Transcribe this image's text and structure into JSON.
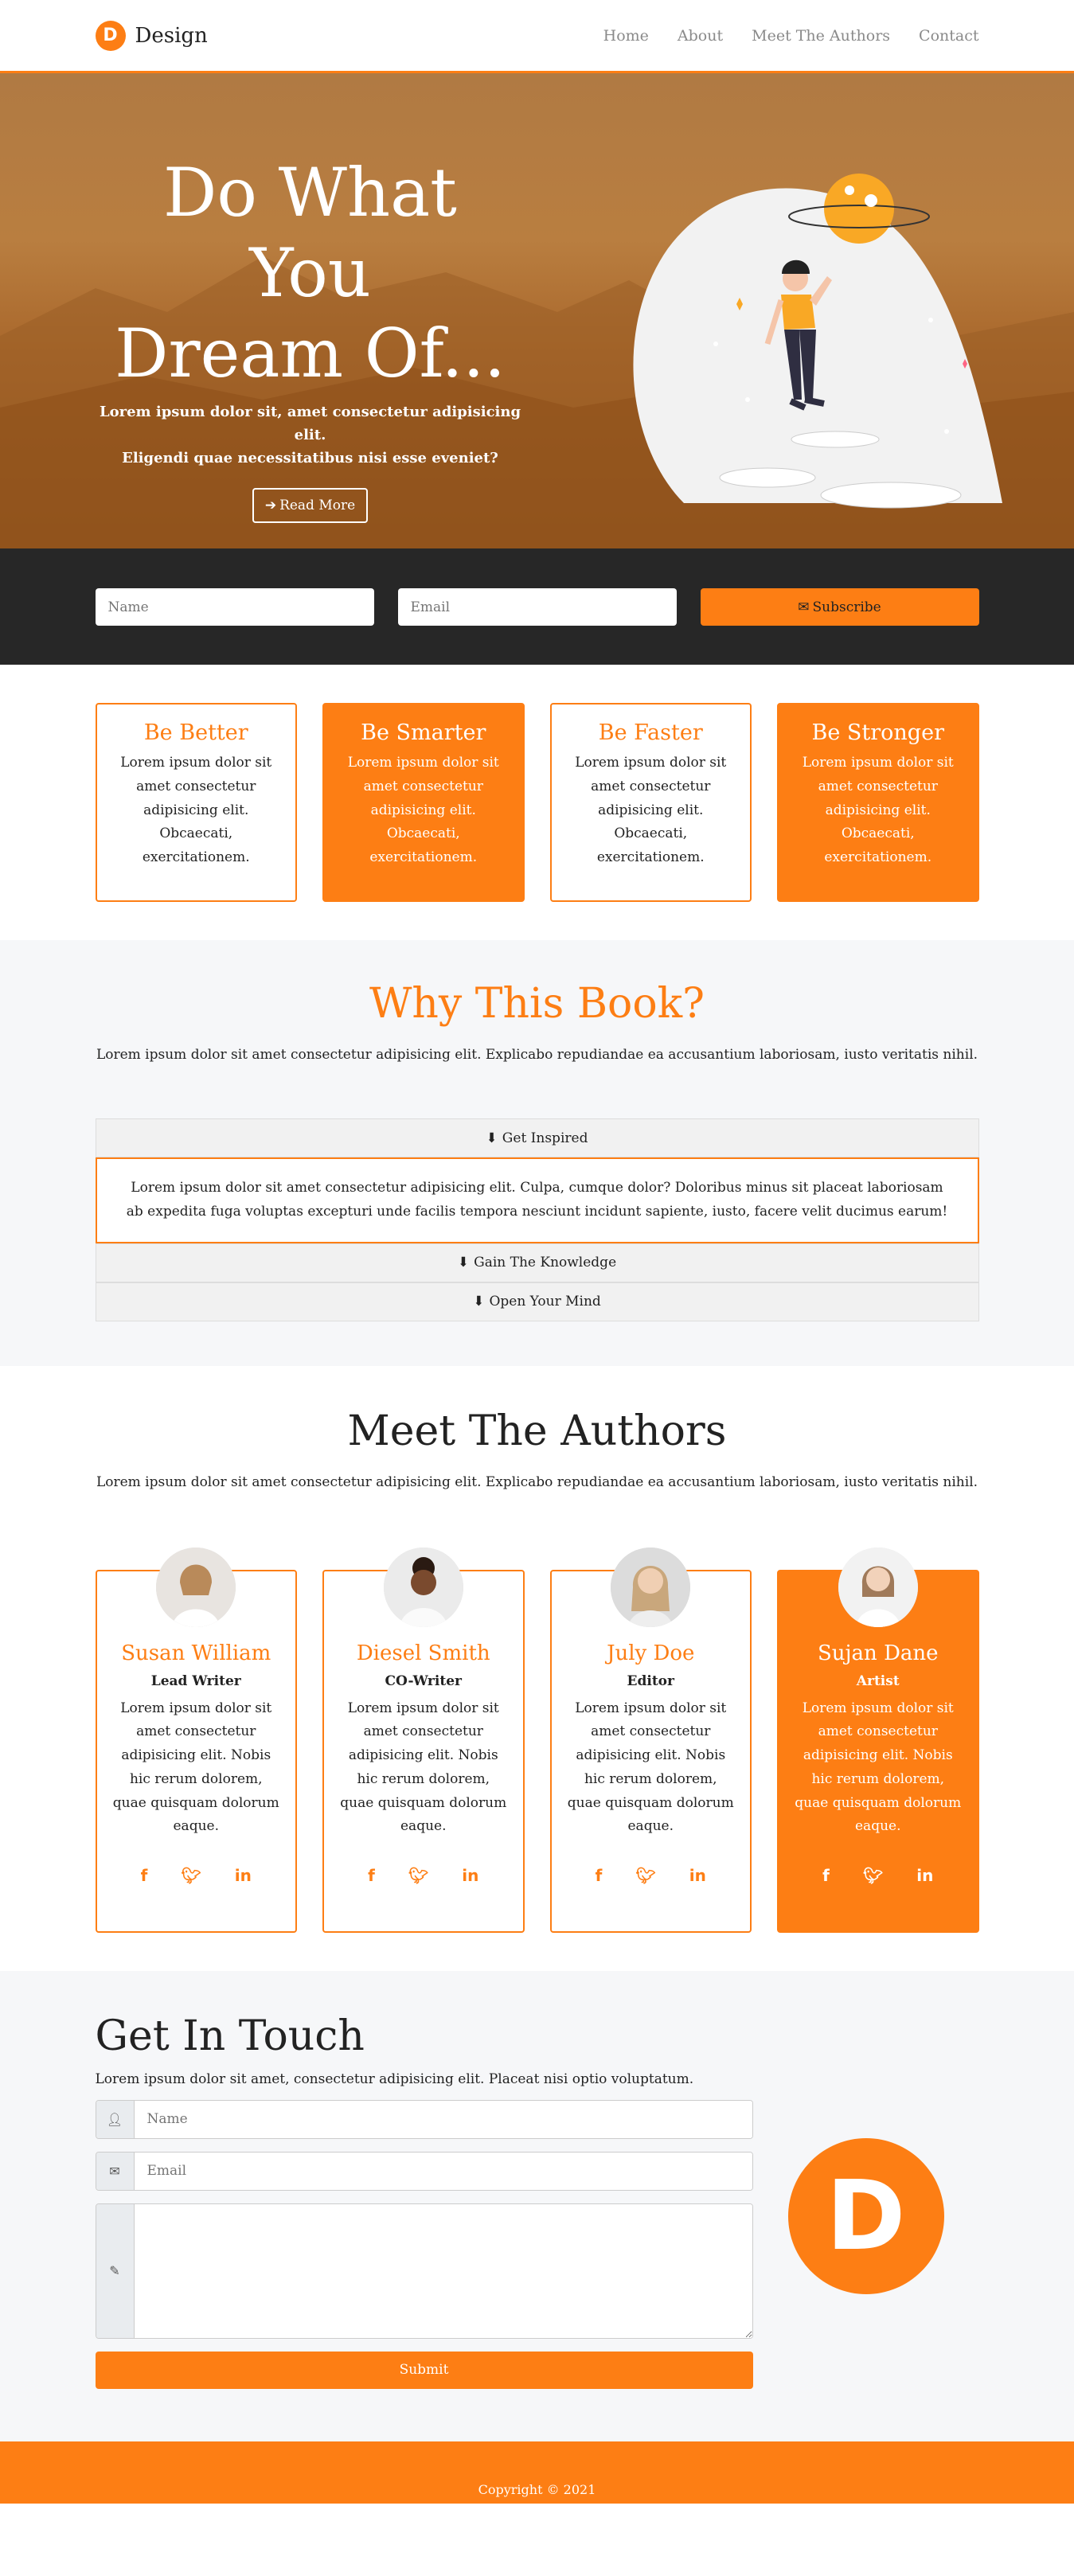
{
  "nav": {
    "logo_letter": "D",
    "brand": "Design",
    "links": [
      "Home",
      "About",
      "Meet The Authors",
      "Contact"
    ]
  },
  "hero": {
    "title_line1": "Do What You",
    "title_line2": "Dream Of...",
    "subtitle_line1": "Lorem ipsum dolor sit, amet consectetur adipisicing elit.",
    "subtitle_line2": "Eligendi quae necessitatibus nisi esse eveniet?",
    "button": "Read More"
  },
  "subscribe": {
    "name_placeholder": "Name",
    "email_placeholder": "Email",
    "button": "Subscribe"
  },
  "features": [
    {
      "title": "Be Better",
      "text": "Lorem ipsum dolor sit amet consectetur adipisicing elit. Obcaecati, exercitationem."
    },
    {
      "title": "Be Smarter",
      "text": "Lorem ipsum dolor sit amet consectetur adipisicing elit. Obcaecati, exercitationem."
    },
    {
      "title": "Be Faster",
      "text": "Lorem ipsum dolor sit amet consectetur adipisicing elit. Obcaecati, exercitationem."
    },
    {
      "title": "Be Stronger",
      "text": "Lorem ipsum dolor sit amet consectetur adipisicing elit. Obcaecati, exercitationem."
    }
  ],
  "why": {
    "title": "Why This Book?",
    "lead": "Lorem ipsum dolor sit amet consectetur adipisicing elit. Explicabo repudiandae ea accusantium laboriosam, iusto veritatis nihil.",
    "accordion": [
      {
        "label": "Get Inspired",
        "body": "Lorem ipsum dolor sit amet consectetur adipisicing elit. Culpa, cumque dolor? Doloribus minus sit placeat laboriosam ab expedita fuga voluptas excepturi unde facilis tempora nesciunt incidunt sapiente, iusto, facere velit ducimus earum!"
      },
      {
        "label": "Gain The Knowledge"
      },
      {
        "label": "Open Your Mind"
      }
    ]
  },
  "authors": {
    "title": "Meet The Authors",
    "lead": "Lorem ipsum dolor sit amet consectetur adipisicing elit. Explicabo repudiandae ea accusantium laboriosam, iusto veritatis nihil.",
    "cards": [
      {
        "name": "Susan William",
        "role": "Lead Writer",
        "text": "Lorem ipsum dolor sit amet consectetur adipisicing elit. Nobis hic rerum dolorem, quae quisquam dolorum eaque."
      },
      {
        "name": "Diesel Smith",
        "role": "CO-Writer",
        "text": "Lorem ipsum dolor sit amet consectetur adipisicing elit. Nobis hic rerum dolorem, quae quisquam dolorum eaque."
      },
      {
        "name": "July Doe",
        "role": "Editor",
        "text": "Lorem ipsum dolor sit amet consectetur adipisicing elit. Nobis hic rerum dolorem, quae quisquam dolorum eaque."
      },
      {
        "name": "Sujan Dane",
        "role": "Artist",
        "text": "Lorem ipsum dolor sit amet consectetur adipisicing elit. Nobis hic rerum dolorem, quae quisquam dolorum eaque."
      }
    ],
    "social": {
      "facebook": "f",
      "twitter": "twitter",
      "linkedin": "in"
    }
  },
  "contact": {
    "title": "Get In Touch",
    "lead": "Lorem ipsum dolor sit amet, consectetur adipisicing elit. Placeat nisi optio voluptatum.",
    "name_placeholder": "Name",
    "email_placeholder": "Email",
    "message_placeholder": "",
    "submit": "Submit",
    "logo_letter": "D"
  },
  "footer": {
    "copyright": "Copyright © 2021"
  },
  "colors": {
    "accent": "#fd7e14",
    "dark": "#272727",
    "light_bg": "#f6f7f9"
  }
}
